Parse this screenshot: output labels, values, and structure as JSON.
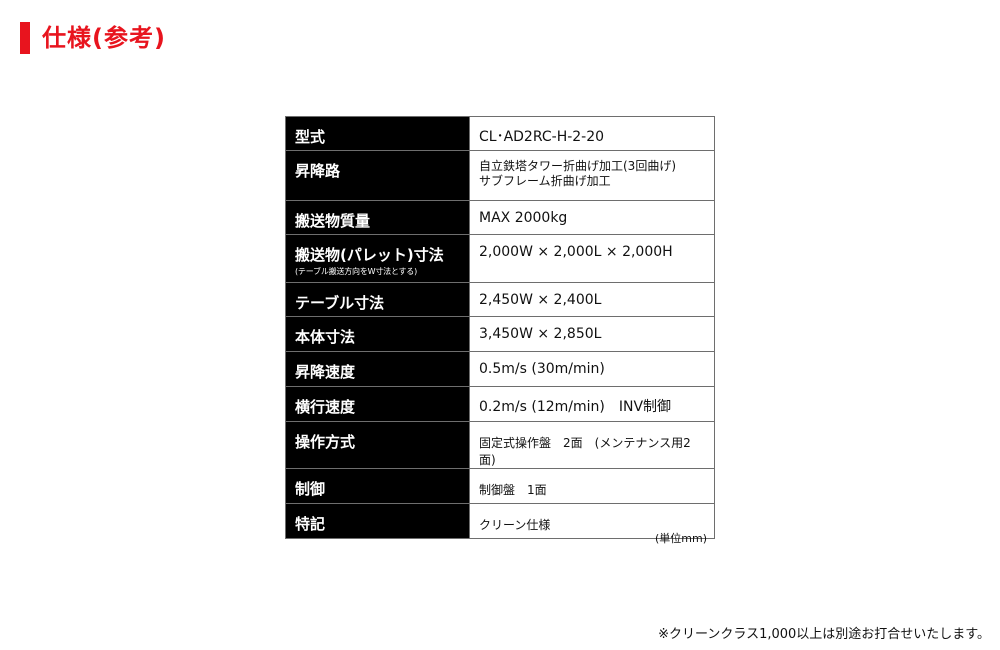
{
  "heading": {
    "title": "仕様(参考)"
  },
  "spec_table": {
    "rows": [
      {
        "label": "型式",
        "value": "CL･AD2RC-H-2-20"
      },
      {
        "label": "昇降路",
        "value_lines": [
          "自立鉄塔タワー折曲げ加工(3回曲げ)",
          "サブフレーム折曲げ加工"
        ]
      },
      {
        "label": "搬送物質量",
        "value": "MAX 2000kg"
      },
      {
        "label": "搬送物(パレット)寸法",
        "sublabel": "(テーブル搬送方向をW寸法とする)",
        "value": "2,000W × 2,000L × 2,000H"
      },
      {
        "label": "テーブル寸法",
        "value": "2,450W × 2,400L"
      },
      {
        "label": "本体寸法",
        "value": "3,450W × 2,850L"
      },
      {
        "label": "昇降速度",
        "value": "0.5m/s (30m/min)"
      },
      {
        "label": "横行速度",
        "value": "0.2m/s (12m/min)　INV制御"
      },
      {
        "label": "操作方式",
        "value": "固定式操作盤　2面　(メンテナンス用2面)"
      },
      {
        "label": "制御",
        "value": "制御盤　1面"
      },
      {
        "label": "特記",
        "value": "クリーン仕様"
      }
    ],
    "unit_note": "(単位mm)"
  },
  "footnote": "※クリーンクラス1,000以上は別途お打合せいたします。",
  "colors": {
    "accent": "#e8141e",
    "label_background": "#000000",
    "label_text": "#ffffff",
    "border": "#6e6e6e"
  }
}
